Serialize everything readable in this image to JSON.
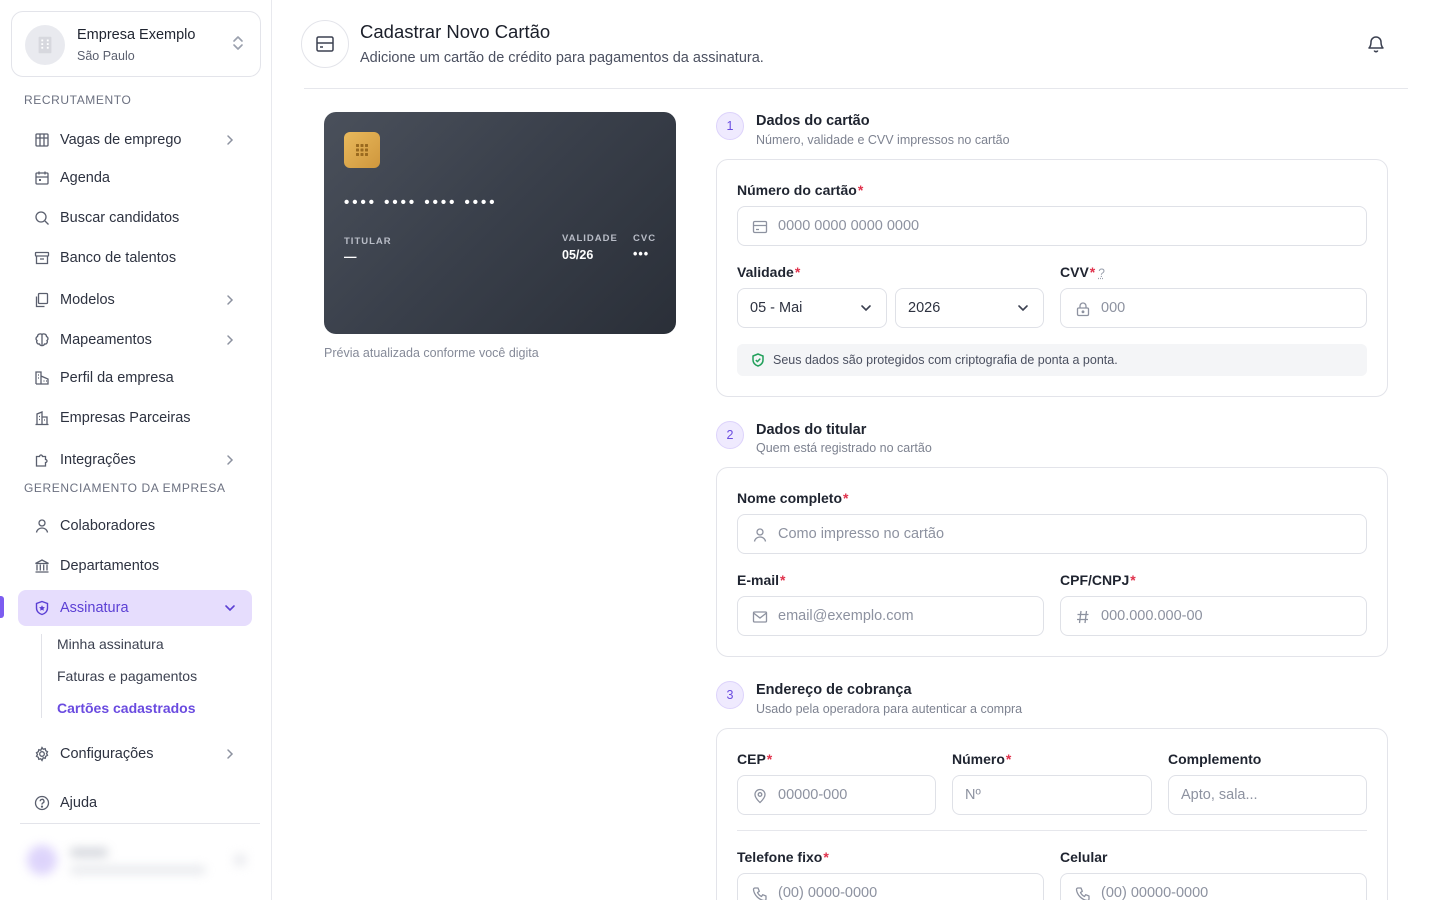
{
  "company": {
    "name": "Empresa Exemplo",
    "city": "São Paulo"
  },
  "sidebar": {
    "section_recruitment": "RECRUTAMENTO",
    "section_management": "GERENCIAMENTO DA EMPRESA",
    "items": [
      {
        "label": "Vagas de emprego",
        "icon": "building-icon",
        "has_chevron": true
      },
      {
        "label": "Agenda",
        "icon": "calendar-icon",
        "has_chevron": false
      },
      {
        "label": "Buscar candidatos",
        "icon": "search-icon",
        "has_chevron": false
      },
      {
        "label": "Banco de talentos",
        "icon": "archive-icon",
        "has_chevron": false
      },
      {
        "label": "Modelos",
        "icon": "copy-icon",
        "has_chevron": true
      },
      {
        "label": "Mapeamentos",
        "icon": "brain-icon",
        "has_chevron": true
      },
      {
        "label": "Perfil da empresa",
        "icon": "factory-icon",
        "has_chevron": false
      },
      {
        "label": "Empresas Parceiras",
        "icon": "buildings-icon",
        "has_chevron": false
      },
      {
        "label": "Integrações",
        "icon": "puzzle-icon",
        "has_chevron": true
      },
      {
        "label": "Colaboradores",
        "icon": "user-icon",
        "has_chevron": false
      },
      {
        "label": "Departamentos",
        "icon": "bank-icon",
        "has_chevron": false
      },
      {
        "label": "Assinatura",
        "icon": "shield-star-icon",
        "has_chevron": true,
        "active": true
      },
      {
        "label": "Configurações",
        "icon": "gear-icon",
        "has_chevron": true
      },
      {
        "label": "Ajuda",
        "icon": "help-circle-icon",
        "has_chevron": false
      }
    ],
    "subitems": [
      {
        "label": "Minha assinatura"
      },
      {
        "label": "Faturas e pagamentos"
      },
      {
        "label": "Cartões cadastrados",
        "current": true
      }
    ]
  },
  "header": {
    "title": "Cadastrar Novo Cartão",
    "subtitle": "Adicione um cartão de crédito para pagamentos da assinatura."
  },
  "card_preview": {
    "number": "•••• •••• •••• ••••",
    "holder_label": "TITULAR",
    "holder_value": "—",
    "expiry_label": "VALIDADE",
    "expiry_value": "05/26",
    "cvc_label": "CVC",
    "cvc_value": "•••",
    "note": "Prévia atualizada conforme você digita"
  },
  "section1": {
    "step": "1",
    "title": "Dados do cartão",
    "subtitle": "Número, validade e CVV impressos no cartão",
    "number_label": "Número do cartão",
    "number_placeholder": "0000 0000 0000 0000",
    "expiry_label": "Validade",
    "month_value": "05 - Mai",
    "year_value": "2026",
    "cvv_label": "CVV",
    "cvv_help": "?",
    "cvv_placeholder": "000",
    "secure_note": "Seus dados são protegidos com criptografia de ponta a ponta."
  },
  "section2": {
    "step": "2",
    "title": "Dados do titular",
    "subtitle": "Quem está registrado no cartão",
    "name_label": "Nome completo",
    "name_placeholder": "Como impresso no cartão",
    "email_label": "E-mail",
    "email_placeholder": "email@exemplo.com",
    "doc_label": "CPF/CNPJ",
    "doc_placeholder": "000.000.000-00"
  },
  "section3": {
    "step": "3",
    "title": "Endereço de cobrança",
    "subtitle": "Usado pela operadora para autenticar a compra",
    "cep_label": "CEP",
    "cep_placeholder": "00000-000",
    "number_label": "Número",
    "number_placeholder": "Nº",
    "complement_label": "Complemento",
    "complement_placeholder": "Apto, sala...",
    "phone_label": "Telefone fixo",
    "phone_placeholder": "(00) 0000-0000",
    "mobile_label": "Celular",
    "mobile_placeholder": "(00) 00000-0000"
  },
  "required_mark": "*",
  "colors": {
    "accent": "#6a4be0",
    "active_bg": "#e6ddfd",
    "required": "#e0314b"
  }
}
